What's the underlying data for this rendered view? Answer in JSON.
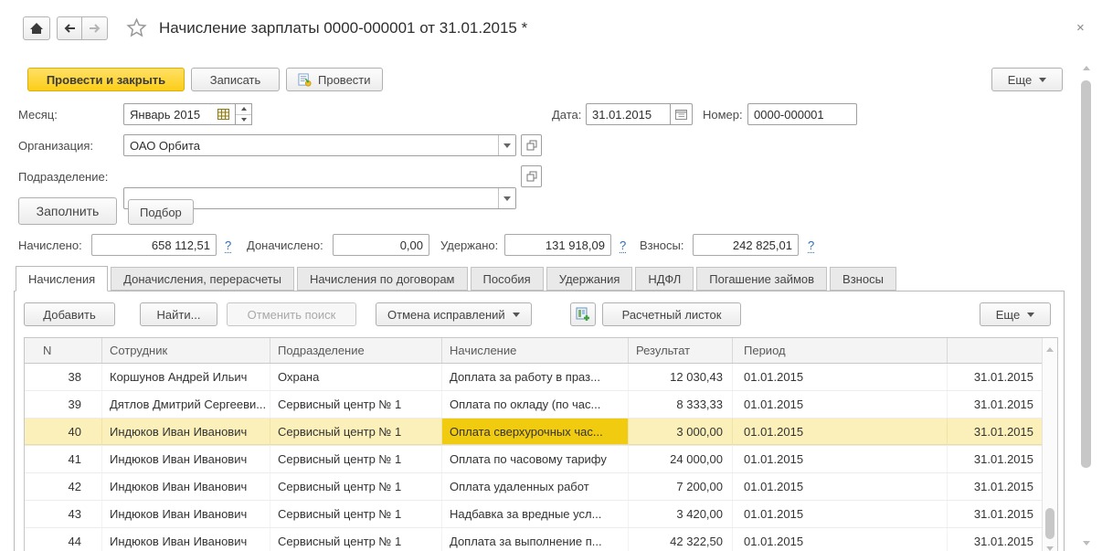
{
  "window": {
    "title": "Начисление зарплаты 0000-000001 от 31.01.2015 *",
    "close": "×"
  },
  "command_bar": {
    "post_and_close": "Провести и закрыть",
    "write": "Записать",
    "post": "Провести",
    "more": "Еще"
  },
  "fields": {
    "month": {
      "label": "Месяц:",
      "value": "Январь 2015"
    },
    "date": {
      "label": "Дата:",
      "value": "31.01.2015"
    },
    "number": {
      "label": "Номер:",
      "value": "0000-000001"
    },
    "organization": {
      "label": "Организация:",
      "value": "ОАО Орбита"
    },
    "department": {
      "label": "Подразделение:",
      "value": ""
    }
  },
  "actions": {
    "fill": "Заполнить",
    "pick": "Подбор"
  },
  "totals": [
    {
      "label": "Начислено:",
      "value": "658 112,51",
      "help": "?"
    },
    {
      "label": "Доначислено:",
      "value": "0,00",
      "help": ""
    },
    {
      "label": "Удержано:",
      "value": "131 918,09",
      "help": "?"
    },
    {
      "label": "Взносы:",
      "value": "242 825,01",
      "help": "?"
    }
  ],
  "tabs": [
    {
      "label": "Начисления"
    },
    {
      "label": "Доначисления, перерасчеты"
    },
    {
      "label": "Начисления по договорам"
    },
    {
      "label": "Пособия"
    },
    {
      "label": "Удержания"
    },
    {
      "label": "НДФЛ"
    },
    {
      "label": "Погашение займов"
    },
    {
      "label": "Взносы"
    }
  ],
  "table_toolbar": {
    "add": "Добавить",
    "find": "Найти...",
    "cancel_search": "Отменить поиск",
    "undo_corrections": "Отмена исправлений",
    "payslip": "Расчетный листок",
    "more": "Еще"
  },
  "table": {
    "columns": [
      "N",
      "Сотрудник",
      "Подразделение",
      "Начисление",
      "Результат",
      "Период",
      ""
    ],
    "rows": [
      {
        "n": "38",
        "employee": "Коршунов Андрей Ильич",
        "department": "Охрана",
        "accrual": "Доплата за работу в праз...",
        "result": "12 030,43",
        "period_start": "01.01.2015",
        "period_end": "31.01.2015"
      },
      {
        "n": "39",
        "employee": "Дятлов Дмитрий Сергееви...",
        "department": "Сервисный центр № 1",
        "accrual": "Оплата по окладу (по час...",
        "result": "8 333,33",
        "period_start": "01.01.2015",
        "period_end": "31.01.2015"
      },
      {
        "n": "40",
        "employee": "Индюков Иван Иванович",
        "department": "Сервисный центр № 1",
        "accrual": "Оплата сверхурочных час...",
        "result": "3 000,00",
        "period_start": "01.01.2015",
        "period_end": "31.01.2015"
      },
      {
        "n": "41",
        "employee": "Индюков Иван Иванович",
        "department": "Сервисный центр № 1",
        "accrual": "Оплата по часовому тарифу",
        "result": "24 000,00",
        "period_start": "01.01.2015",
        "period_end": "31.01.2015"
      },
      {
        "n": "42",
        "employee": "Индюков Иван Иванович",
        "department": "Сервисный центр № 1",
        "accrual": "Оплата удаленных работ",
        "result": "7 200,00",
        "period_start": "01.01.2015",
        "period_end": "31.01.2015"
      },
      {
        "n": "43",
        "employee": "Индюков Иван Иванович",
        "department": "Сервисный центр № 1",
        "accrual": "Надбавка за вредные усл...",
        "result": "3 420,00",
        "period_start": "01.01.2015",
        "period_end": "31.01.2015"
      },
      {
        "n": "44",
        "employee": "Индюков Иван Иванович",
        "department": "Сервисный центр № 1",
        "accrual": "Доплата за выполнение п...",
        "result": "42 322,50",
        "period_start": "01.01.2015",
        "period_end": "31.01.2015"
      }
    ]
  },
  "colors": {
    "accent_yellow": "#fcce18",
    "selection_row": "#fbf0ba",
    "selection_cell": "#f1cb10",
    "help_link": "#2b6cb8"
  }
}
